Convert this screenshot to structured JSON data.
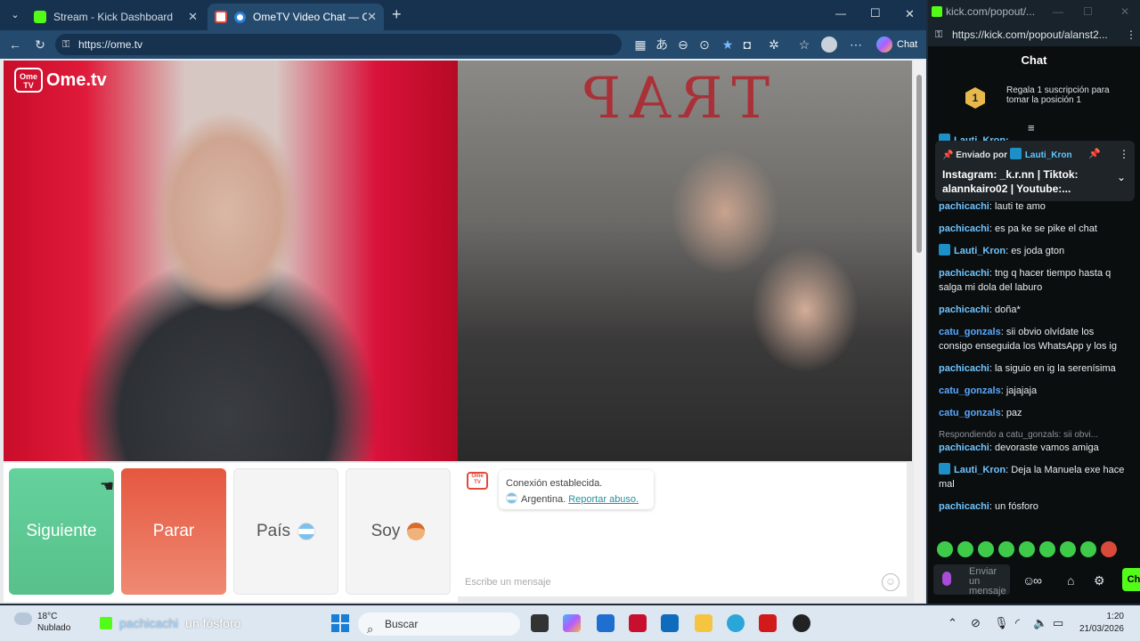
{
  "browser": {
    "tabs": [
      {
        "label": "Stream - Kick Dashboard",
        "close": "✕"
      },
      {
        "label": "OmeTV Video Chat — Omegl",
        "close": "✕"
      }
    ],
    "new_tab": "+",
    "window_controls": {
      "minimize": "—",
      "maximize": "☐",
      "close": "✕"
    },
    "url": "https://ome.tv",
    "copilot_label": "Chat",
    "accent": "#244a6e"
  },
  "ometv": {
    "logo_box": "Ome TV",
    "logo_text": "Ome.tv",
    "wall_text": "TRAP",
    "buttons": {
      "next": "Siguiente",
      "stop": "Parar",
      "country": "País",
      "soy": "Soy"
    },
    "chat": {
      "system_icon": "Ome TV",
      "status_line": "Conexión establecida.",
      "country": "Argentina.",
      "report_link": "Reportar abuso.",
      "input_placeholder": "Escribe un mensaje"
    },
    "colors": {
      "next": "#5cc792",
      "stop": "#e9674f"
    }
  },
  "kick": {
    "window_title": "kick.com/popout/...",
    "url": "https://kick.com/popout/alanst2...",
    "chat_title": "Chat",
    "gift": {
      "badge": "1",
      "text": "Regala 1 suscripción para tomar la posición 1"
    },
    "pinned": {
      "sent_by": "Enviado por",
      "user": "Lauti_Kron",
      "text": "Instagram: _k.r.nn | Tiktok: alannkairo02 | Youtube:...",
      "partial_above": "Lauti_Kron:"
    },
    "messages": [
      {
        "user": "pachicachi",
        "color": "#6fc4ff",
        "badge": false,
        "reply": "",
        "text": "lauti te amo"
      },
      {
        "user": "pachicachi",
        "color": "#6fc4ff",
        "badge": false,
        "reply": "",
        "text": "es pa ke se pike el chat"
      },
      {
        "user": "Lauti_Kron",
        "color": "#6fc4ff",
        "badge": true,
        "reply": "",
        "text": "es joda gton"
      },
      {
        "user": "pachicachi",
        "color": "#6fc4ff",
        "badge": false,
        "reply": "",
        "text": "tng q hacer tiempo hasta q salga mi dola del laburo"
      },
      {
        "user": "pachicachi",
        "color": "#6fc4ff",
        "badge": false,
        "reply": "",
        "text": "doña*"
      },
      {
        "user": "catu_gonzals",
        "color": "#5aa9ff",
        "badge": false,
        "reply": "",
        "text": "sii obvio olvídate los consigo enseguida los WhatsApp y los ig"
      },
      {
        "user": "pachicachi",
        "color": "#6fc4ff",
        "badge": false,
        "reply": "",
        "text": "la siguio en ig la serenísima"
      },
      {
        "user": "catu_gonzals",
        "color": "#5aa9ff",
        "badge": false,
        "reply": "",
        "text": "jajajaja"
      },
      {
        "user": "catu_gonzals",
        "color": "#5aa9ff",
        "badge": false,
        "reply": "",
        "text": "paz"
      },
      {
        "user": "pachicachi",
        "color": "#6fc4ff",
        "badge": false,
        "reply": "Respondiendo a catu_gonzals: sii obvi...",
        "text": "devoraste vamos amiga"
      },
      {
        "user": "Lauti_Kron",
        "color": "#6fc4ff",
        "badge": true,
        "reply": "",
        "text": "Deja la Manuela exe hace mal"
      },
      {
        "user": "pachicachi",
        "color": "#6fc4ff",
        "badge": false,
        "reply": "",
        "text": "un fósforo"
      }
    ],
    "input_placeholder": "Enviar un mensaje",
    "send_label": "Ch",
    "brand": "#53fc18"
  },
  "taskbar": {
    "weather_temp": "18°C",
    "weather_desc": "Nublado",
    "now_user": "pachicachi",
    "now_text": "un fósforo",
    "search": "Buscar",
    "time": "1:20",
    "date": "21/03/2026"
  }
}
